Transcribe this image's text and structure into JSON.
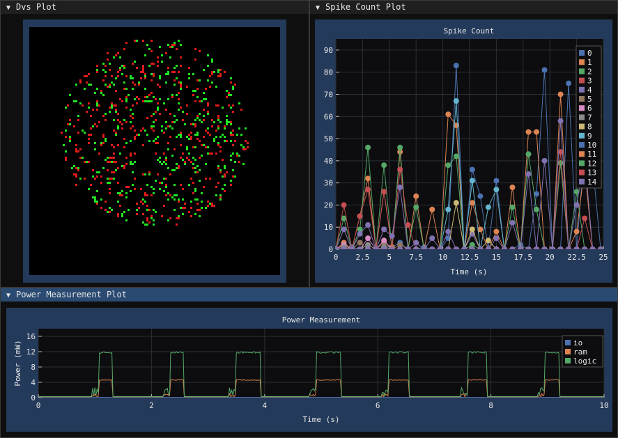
{
  "windows": {
    "dvs": {
      "title": "Dvs Plot"
    },
    "spike": {
      "title": "Spike Count Plot"
    },
    "power": {
      "title": "Power Measurement Plot"
    }
  },
  "colors": {
    "dvs_on": "#22e622",
    "dvs_off": "#e01b1b",
    "io": "#4c72b0",
    "ram": "#dd8452",
    "logic": "#55a868"
  },
  "chart_data": [
    {
      "type": "line",
      "title": "Spike Count",
      "xlabel": "Time (s)",
      "ylabel": "",
      "xlim": [
        0,
        25
      ],
      "ylim": [
        0,
        95
      ],
      "x_ticks": [
        "0",
        "2.5",
        "5",
        "7.5",
        "10",
        "12.5",
        "15",
        "17.5",
        "20",
        "22.5",
        "25"
      ],
      "y_ticks": [
        "0",
        "10",
        "20",
        "30",
        "40",
        "50",
        "60",
        "70",
        "80",
        "90"
      ],
      "grid": true,
      "legend_position": "top-right",
      "x": [
        0,
        0.75,
        1.5,
        2.25,
        3,
        3.75,
        4.5,
        5.25,
        6,
        6.75,
        7.5,
        8.25,
        9,
        9.75,
        10.5,
        11.25,
        12,
        12.75,
        13.5,
        14.25,
        15,
        15.75,
        16.5,
        17.25,
        18,
        18.75,
        19.5,
        20.25,
        21,
        21.75,
        22.5,
        23.25,
        24,
        24.75
      ],
      "series": [
        {
          "name": "0",
          "color": "#4c72b0",
          "values": [
            0,
            0,
            1,
            0,
            2,
            0,
            1,
            1,
            3,
            0,
            0,
            1,
            0,
            0,
            5,
            83,
            0,
            36,
            24,
            0,
            31,
            0,
            0,
            2,
            0,
            25,
            81,
            0,
            0,
            75,
            0,
            46,
            38,
            0
          ]
        },
        {
          "name": "1",
          "color": "#dd8452",
          "values": [
            0,
            3,
            0,
            15,
            32,
            0,
            26,
            1,
            44,
            0,
            24,
            0,
            18,
            0,
            61,
            56,
            0,
            21,
            9,
            0,
            8,
            0,
            28,
            0,
            53,
            53,
            0,
            0,
            70,
            0,
            8,
            37,
            0,
            0
          ]
        },
        {
          "name": "2",
          "color": "#55a868",
          "values": [
            0,
            14,
            0,
            9,
            46,
            0,
            38,
            0,
            46,
            0,
            19,
            0,
            0,
            0,
            38,
            42,
            0,
            2,
            0,
            0,
            0,
            0,
            19,
            0,
            43,
            18,
            0,
            0,
            39,
            0,
            26,
            0,
            0,
            0
          ]
        },
        {
          "name": "3",
          "color": "#c44e52",
          "values": [
            0,
            20,
            0,
            15,
            27,
            0,
            26,
            0,
            36,
            11,
            0,
            0,
            0,
            0,
            0,
            0,
            0,
            0,
            0,
            0,
            0,
            0,
            0,
            0,
            0,
            0,
            0,
            0,
            44,
            0,
            0,
            14,
            0,
            0
          ]
        },
        {
          "name": "4",
          "color": "#8172b3",
          "values": [
            0,
            9,
            0,
            7,
            11,
            0,
            9,
            6,
            28,
            0,
            3,
            0,
            5,
            0,
            8,
            0,
            0,
            7,
            0,
            0,
            5,
            0,
            12,
            0,
            34,
            0,
            40,
            0,
            58,
            0,
            20,
            42,
            0,
            0
          ]
        },
        {
          "name": "5",
          "color": "#937860",
          "values": [
            0,
            2,
            0,
            3,
            0,
            0,
            3,
            0,
            2,
            0,
            0,
            0,
            0,
            0,
            0,
            0,
            0,
            0,
            0,
            0,
            0,
            0,
            0,
            0,
            0,
            0,
            0,
            0,
            0,
            0,
            0,
            0,
            0,
            0
          ]
        },
        {
          "name": "6",
          "color": "#da8bc3",
          "values": [
            0,
            2,
            0,
            0,
            5,
            0,
            4,
            0,
            0,
            0,
            0,
            0,
            0,
            0,
            0,
            0,
            0,
            0,
            0,
            0,
            0,
            0,
            0,
            0,
            0,
            0,
            0,
            0,
            0,
            0,
            0,
            0,
            0,
            0
          ]
        },
        {
          "name": "7",
          "color": "#8c8c8c",
          "values": [
            0,
            1,
            0,
            0,
            2,
            0,
            1,
            0,
            0,
            0,
            0,
            0,
            0,
            0,
            0,
            0,
            0,
            0,
            0,
            0,
            0,
            0,
            0,
            0,
            0,
            0,
            0,
            0,
            0,
            0,
            0,
            0,
            0,
            0
          ]
        },
        {
          "name": "8",
          "color": "#ccb974",
          "values": [
            0,
            0,
            0,
            0,
            0,
            0,
            0,
            0,
            0,
            0,
            0,
            0,
            0,
            0,
            0,
            21,
            0,
            9,
            0,
            4,
            0,
            0,
            0,
            0,
            0,
            0,
            0,
            0,
            0,
            0,
            0,
            0,
            0,
            0
          ]
        },
        {
          "name": "9",
          "color": "#64b5cd",
          "values": [
            0,
            0,
            0,
            0,
            0,
            0,
            0,
            0,
            0,
            0,
            0,
            0,
            0,
            0,
            18,
            67,
            0,
            31,
            0,
            19,
            27,
            0,
            0,
            0,
            0,
            0,
            0,
            0,
            0,
            0,
            0,
            0,
            0,
            0
          ]
        },
        {
          "name": "10",
          "color": "#4c72b0",
          "values": [
            0,
            0,
            0,
            0,
            0,
            0,
            0,
            0,
            0,
            0,
            0,
            0,
            0,
            0,
            0,
            0,
            0,
            0,
            0,
            0,
            0,
            0,
            0,
            0,
            0,
            0,
            0,
            0,
            0,
            0,
            0,
            0,
            0,
            0
          ]
        },
        {
          "name": "11",
          "color": "#dd8452",
          "values": [
            0,
            0,
            0,
            0,
            0,
            0,
            0,
            0,
            0,
            0,
            0,
            0,
            0,
            0,
            0,
            0,
            0,
            0,
            0,
            0,
            0,
            0,
            0,
            0,
            0,
            0,
            0,
            0,
            0,
            0,
            0,
            0,
            0,
            0
          ]
        },
        {
          "name": "12",
          "color": "#55a868",
          "values": [
            0,
            0,
            0,
            0,
            0,
            0,
            0,
            0,
            0,
            0,
            0,
            0,
            0,
            0,
            0,
            0,
            0,
            0,
            0,
            0,
            0,
            0,
            0,
            0,
            0,
            0,
            0,
            0,
            0,
            0,
            0,
            0,
            0,
            0
          ]
        },
        {
          "name": "13",
          "color": "#c44e52",
          "values": [
            0,
            0,
            0,
            0,
            0,
            0,
            0,
            0,
            0,
            0,
            0,
            0,
            0,
            0,
            0,
            0,
            0,
            0,
            0,
            0,
            0,
            0,
            0,
            0,
            0,
            0,
            0,
            0,
            0,
            0,
            0,
            0,
            0,
            0
          ]
        },
        {
          "name": "14",
          "color": "#8172b3",
          "values": [
            0,
            0,
            0,
            0,
            0,
            0,
            0,
            0,
            0,
            0,
            0,
            0,
            0,
            0,
            0,
            0,
            0,
            0,
            0,
            0,
            0,
            0,
            0,
            0,
            0,
            0,
            0,
            0,
            0,
            0,
            0,
            0,
            0,
            0
          ]
        }
      ]
    },
    {
      "type": "line",
      "title": "Power Measurement",
      "xlabel": "Time (s)",
      "ylabel": "Power (mW)",
      "xlim": [
        0,
        10
      ],
      "ylim": [
        0,
        18
      ],
      "x_ticks": [
        "0",
        "2",
        "4",
        "6",
        "8",
        "10"
      ],
      "y_ticks": [
        "0",
        "4",
        "8",
        "12",
        "16"
      ],
      "grid": true,
      "legend_position": "top-right",
      "pulses_s": [
        [
          1.08,
          1.32
        ],
        [
          2.33,
          2.58
        ],
        [
          3.5,
          3.93
        ],
        [
          4.9,
          5.34
        ],
        [
          6.18,
          6.54
        ],
        [
          7.58,
          7.92
        ],
        [
          8.95,
          9.21
        ]
      ],
      "series": [
        {
          "name": "io",
          "color": "#4c72b0",
          "baseline": 0.1,
          "high": 0.1
        },
        {
          "name": "ram",
          "color": "#dd8452",
          "baseline": 0.2,
          "high": 4.6
        },
        {
          "name": "logic",
          "color": "#55a868",
          "baseline": 0.3,
          "high": 11.8
        }
      ]
    }
  ]
}
